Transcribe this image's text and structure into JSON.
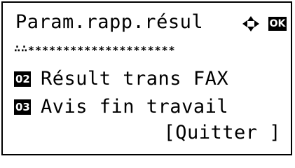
{
  "screen": {
    "title": "Param.rapp.résul",
    "nav_icon": "up-down-arrows-icon",
    "ok_label": "OK",
    "rule": "∴∴∗∗∗∗∗∗∗∗∗∗∗∗∗∗∗∗∗∗∗∗∗"
  },
  "menu": {
    "items": [
      {
        "number": "02",
        "label": "Résult trans FAX"
      },
      {
        "number": "03",
        "label": "Avis fin travail"
      }
    ]
  },
  "footer": {
    "quit_label": "[Quitter ]"
  },
  "colors": {
    "foreground": "#000000",
    "background": "#ffffff"
  }
}
